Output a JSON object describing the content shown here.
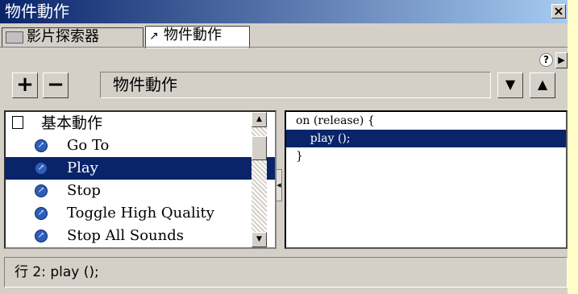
{
  "window": {
    "title": "物件動作",
    "close_label": "×"
  },
  "tabs": [
    {
      "label": "影片探索器",
      "icon": "movie-explorer-icon"
    },
    {
      "label": "物件動作",
      "icon": "arrow-icon"
    }
  ],
  "tab_controls": {
    "help_label": "?",
    "arrow_label": "▶"
  },
  "toolbar": {
    "add_label": "+",
    "remove_label": "−",
    "action_name": "物件動作",
    "move_down_label": "▼",
    "move_up_label": "▲"
  },
  "actions_list": {
    "group_label": "基本動作",
    "items": [
      {
        "label": "Go To",
        "selected": false
      },
      {
        "label": "Play",
        "selected": true
      },
      {
        "label": "Stop",
        "selected": false
      },
      {
        "label": "Toggle High Quality",
        "selected": false
      },
      {
        "label": "Stop All Sounds",
        "selected": false
      }
    ]
  },
  "script_lines": [
    {
      "text": "on (release) {",
      "selected": false
    },
    {
      "text": "    play ();",
      "selected": true
    },
    {
      "text": "}",
      "selected": false
    }
  ],
  "status": {
    "text": "行 2: play ();"
  }
}
